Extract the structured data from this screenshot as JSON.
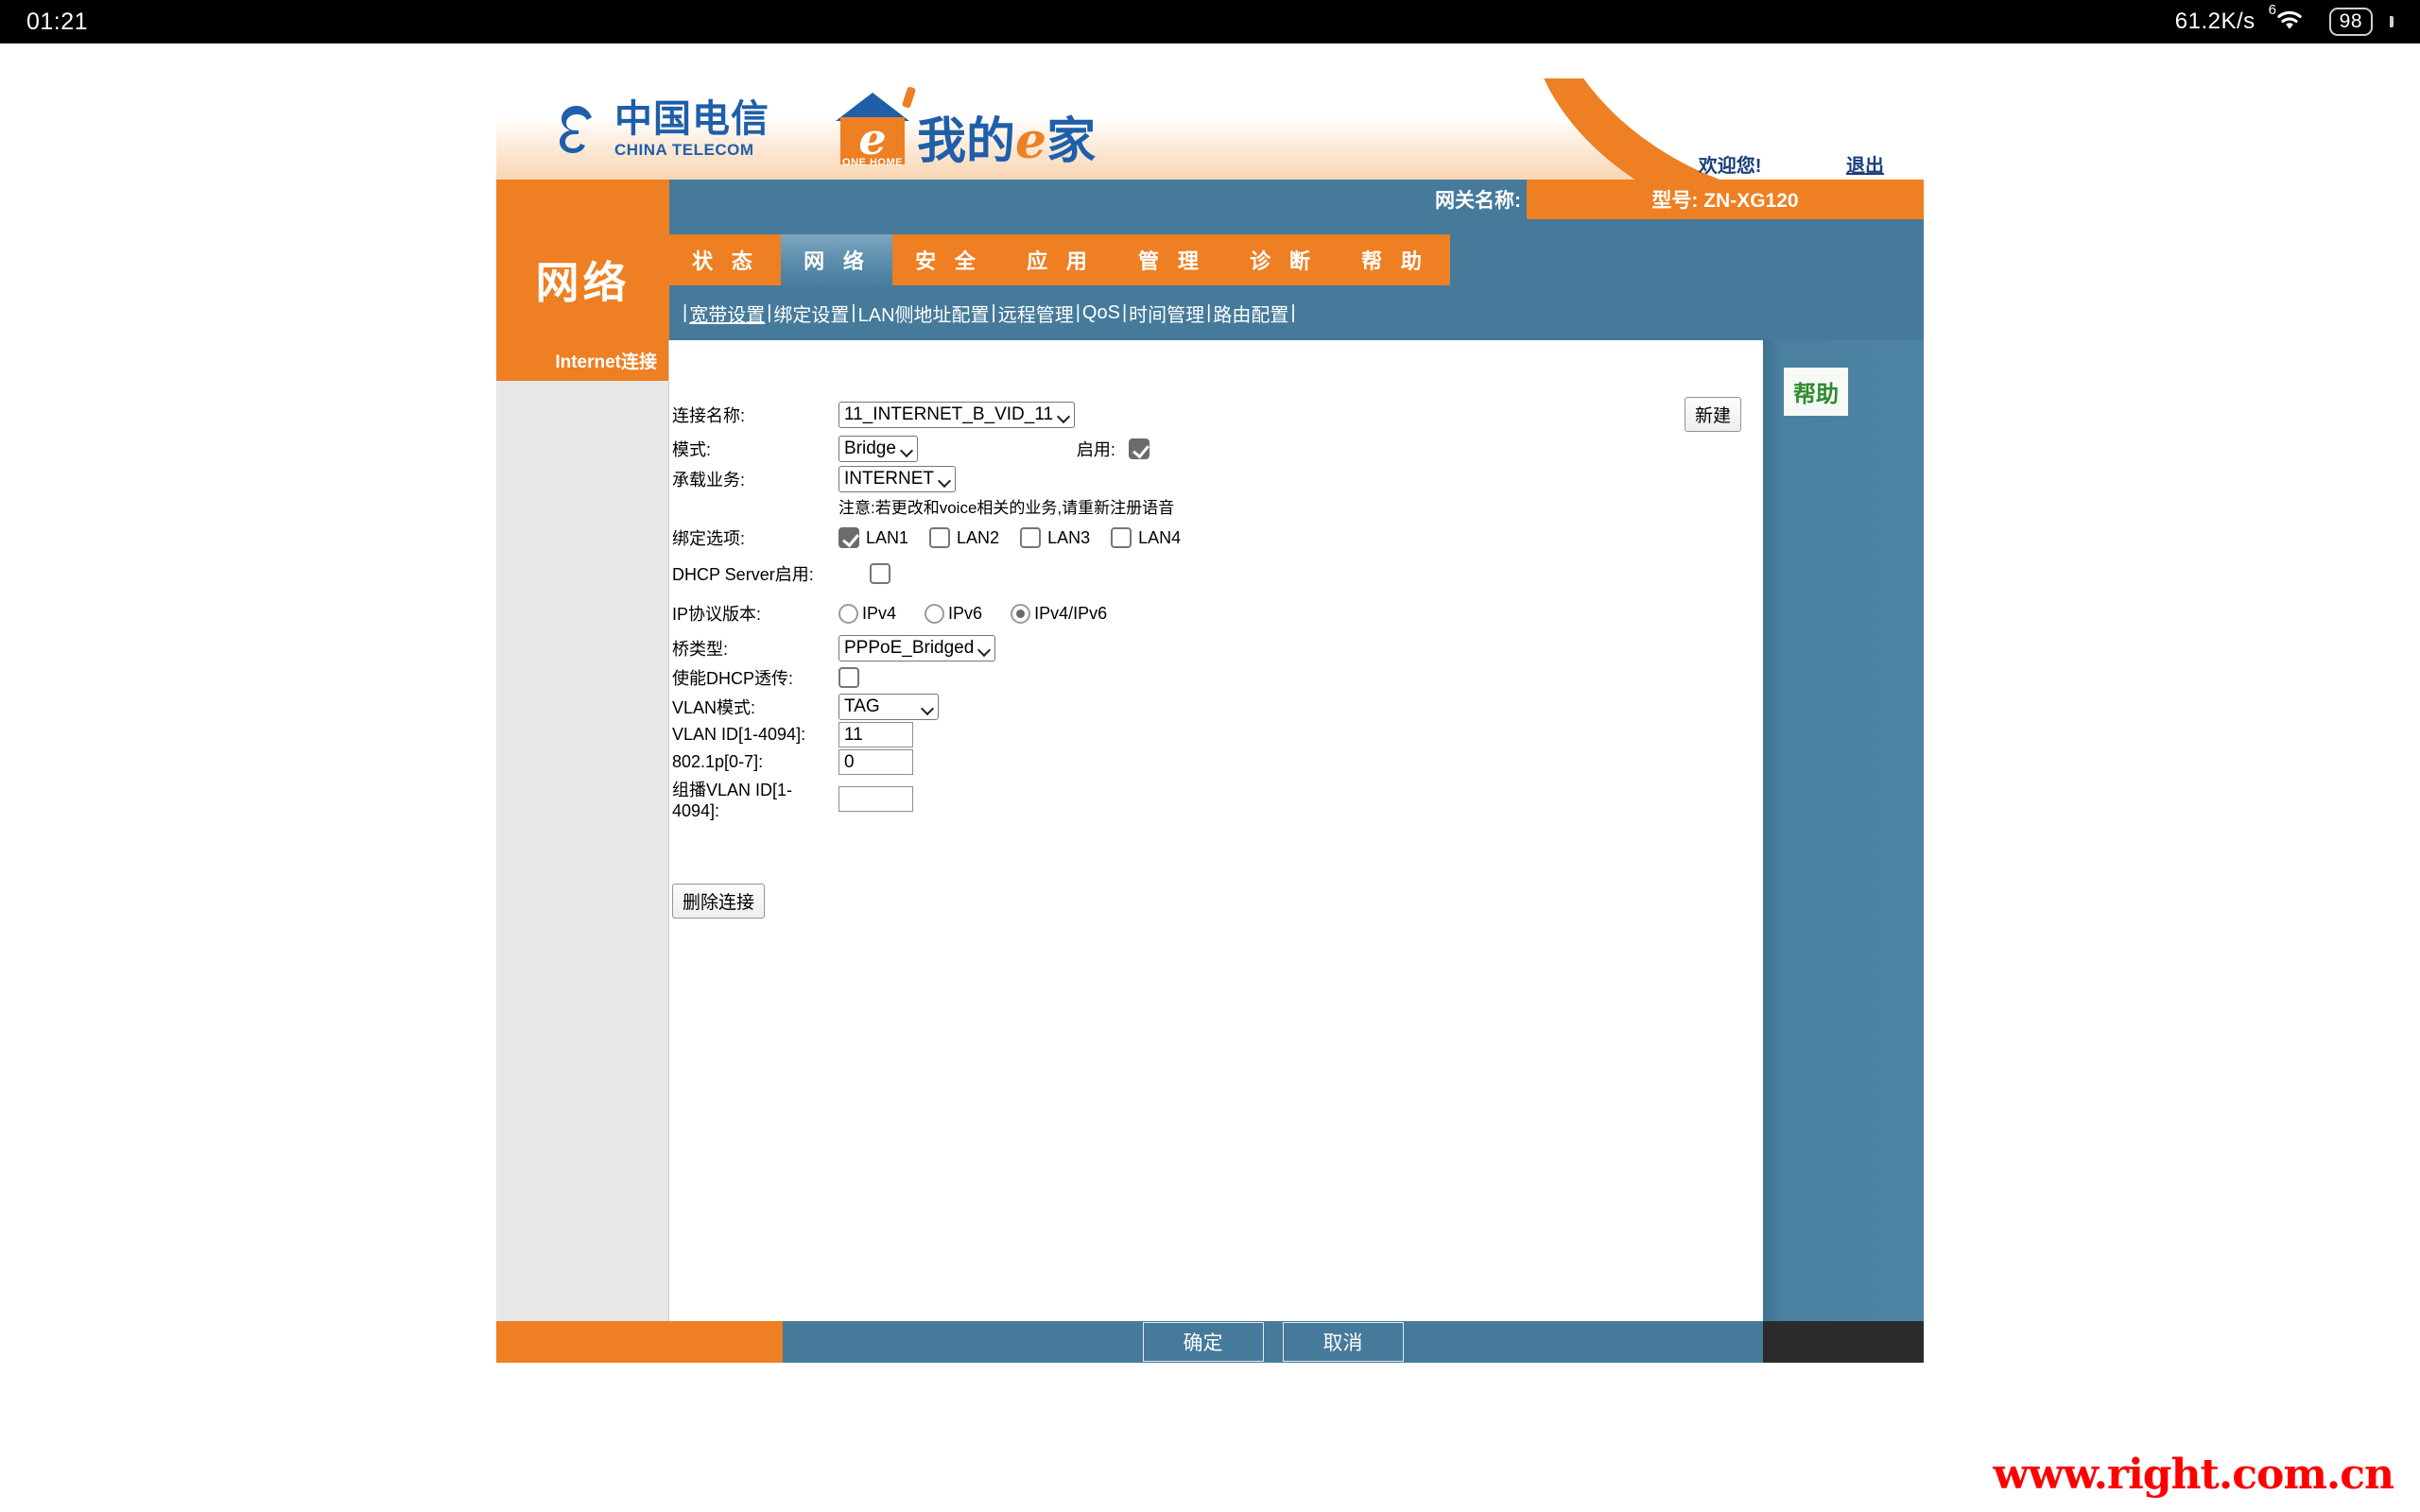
{
  "statusbar": {
    "time": "01:21",
    "net_speed": "61.2K/s",
    "wifi_generation": "6",
    "battery": "98"
  },
  "banner": {
    "telecom_cn": "中国电信",
    "telecom_en": "CHINA TELECOM",
    "ehome_e": "e",
    "ehome_onehome": "ONE HOME",
    "ehome_words_1": "我的",
    "ehome_words_e": "e",
    "ehome_words_2": "家",
    "welcome": "欢迎您!",
    "logout": "退出"
  },
  "gateway": {
    "name_label": "网关名称:",
    "model": "型号: ZN-XG120"
  },
  "nav": {
    "section_title": "网络",
    "tabs": [
      {
        "label": "状 态",
        "active": false
      },
      {
        "label": "网 络",
        "active": true
      },
      {
        "label": "安 全",
        "active": false
      },
      {
        "label": "应 用",
        "active": false
      },
      {
        "label": "管 理",
        "active": false
      },
      {
        "label": "诊 断",
        "active": false
      },
      {
        "label": "帮 助",
        "active": false
      }
    ],
    "submenu": [
      {
        "label": "宽带设置",
        "active": true
      },
      {
        "label": "绑定设置",
        "active": false
      },
      {
        "label": "LAN侧地址配置",
        "active": false
      },
      {
        "label": "远程管理",
        "active": false
      },
      {
        "label": "QoS",
        "active": false
      },
      {
        "label": "时间管理",
        "active": false
      },
      {
        "label": "路由配置",
        "active": false
      }
    ]
  },
  "sidebar": {
    "header": "Internet连接"
  },
  "help": {
    "label": "帮助"
  },
  "form": {
    "connection_name_label": "连接名称:",
    "connection_name_value": "11_INTERNET_B_VID_11",
    "new_button": "新建",
    "mode_label": "模式:",
    "mode_value": "Bridge",
    "enable_label": "启用:",
    "enable_checked": "true",
    "service_label": "承载业务:",
    "service_value": "INTERNET",
    "note": "注意:若更改和voice相关的业务,请重新注册语音",
    "bind_label": "绑定选项:",
    "lan": [
      {
        "label": "LAN1",
        "checked": "true"
      },
      {
        "label": "LAN2",
        "checked": "false"
      },
      {
        "label": "LAN3",
        "checked": "false"
      },
      {
        "label": "LAN4",
        "checked": "false"
      }
    ],
    "dhcp_server_label": "DHCP Server启用:",
    "dhcp_server_checked": "false",
    "ip_version_label": "IP协议版本:",
    "ip_versions": [
      {
        "label": "IPv4",
        "selected": "false"
      },
      {
        "label": "IPv6",
        "selected": "false"
      },
      {
        "label": "IPv4/IPv6",
        "selected": "true"
      }
    ],
    "bridge_type_label": "桥类型:",
    "bridge_type_value": "PPPoE_Bridged",
    "dhcp_passthrough_label": "使能DHCP透传:",
    "dhcp_passthrough_checked": "false",
    "vlan_mode_label": "VLAN模式:",
    "vlan_mode_value": "TAG",
    "vlan_id_label": "VLAN ID[1-4094]:",
    "vlan_id_value": "11",
    "p8021p_label": "802.1p[0-7]:",
    "p8021p_value": "0",
    "mcast_vlan_label": "组播VLAN ID[1-4094]:",
    "mcast_vlan_value": "",
    "delete_button": "删除连接"
  },
  "footer": {
    "ok": "确定",
    "cancel": "取消"
  },
  "watermark": "www.right.com.cn"
}
